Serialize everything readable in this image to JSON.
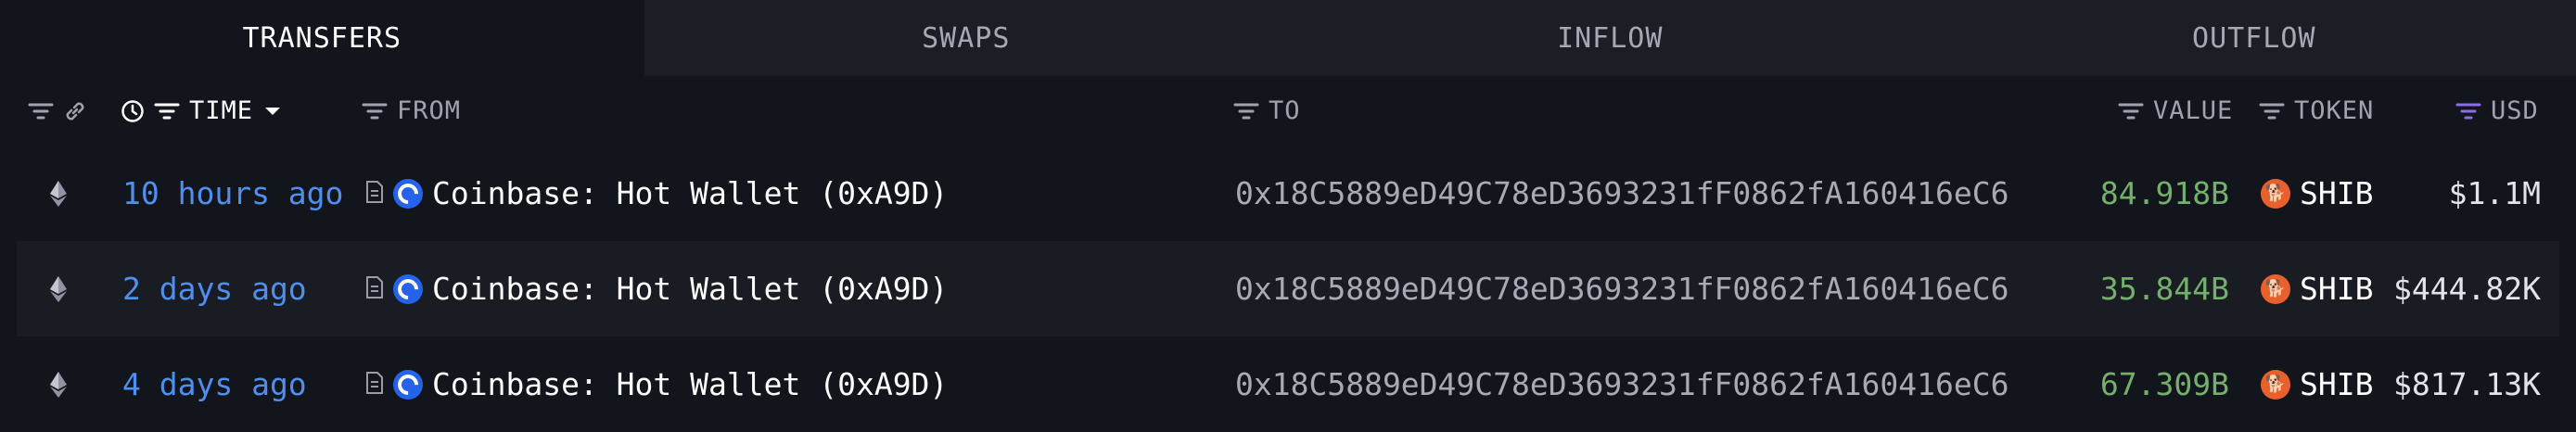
{
  "tabs": [
    {
      "label": "TRANSFERS",
      "active": true
    },
    {
      "label": "SWAPS",
      "active": false
    },
    {
      "label": "INFLOW",
      "active": false
    },
    {
      "label": "OUTFLOW",
      "active": false
    }
  ],
  "columns": {
    "time": "TIME",
    "from": "FROM",
    "to": "TO",
    "value": "VALUE",
    "token": "TOKEN",
    "usd": "USD"
  },
  "rows": [
    {
      "chain_icon": "ethereum-icon",
      "time": "10 hours ago",
      "from": "Coinbase: Hot Wallet (0xA9D)",
      "to": "0x18C5889eD49C78eD3693231fF0862fA160416eC6",
      "value": "84.918B",
      "token": "SHIB",
      "usd": "$1.1M"
    },
    {
      "chain_icon": "ethereum-icon",
      "time": "2 days ago",
      "from": "Coinbase: Hot Wallet (0xA9D)",
      "to": "0x18C5889eD49C78eD3693231fF0862fA160416eC6",
      "value": "35.844B",
      "token": "SHIB",
      "usd": "$444.82K"
    },
    {
      "chain_icon": "ethereum-icon",
      "time": "4 days ago",
      "from": "Coinbase: Hot Wallet (0xA9D)",
      "to": "0x18C5889eD49C78eD3693231fF0862fA160416eC6",
      "value": "67.309B",
      "token": "SHIB",
      "usd": "$817.13K"
    }
  ],
  "colors": {
    "background": "#13151d",
    "time_link": "#4f8fef",
    "value_green": "#74b06c",
    "usd_filter_accent": "#8b6cf0"
  }
}
